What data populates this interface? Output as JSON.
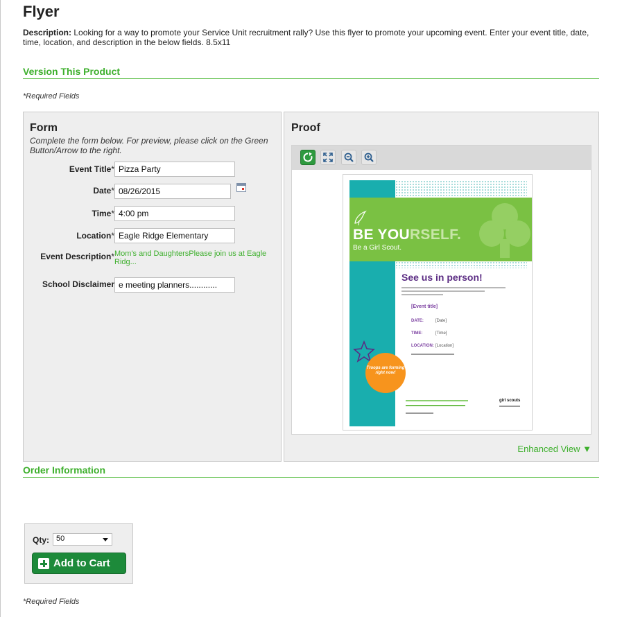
{
  "page": {
    "title": "Flyer",
    "description_label": "Description:",
    "description": "Looking for a way to promote your Service Unit recruitment rally? Use this flyer to promote your upcoming event. Enter your event title, date, time, location, and description in the below fields. 8.5x11"
  },
  "sections": {
    "version": "Version This Product",
    "order": "Order Information",
    "required_top": "*Required Fields",
    "required_bottom": "*Required Fields"
  },
  "form": {
    "title": "Form",
    "help": "Complete the form below. For preview, please click on the Green Button/Arrow to the right.",
    "fields": {
      "event_title": {
        "label": "Event Title",
        "value": "Pizza Party"
      },
      "date": {
        "label": "Date",
        "value": "08/26/2015"
      },
      "time": {
        "label": "Time",
        "value": "4:00 pm"
      },
      "location": {
        "label": "Location",
        "value": "Eagle Ridge Elementary"
      },
      "event_description": {
        "label": "Event Description",
        "value": "Mom's and DaughtersPlease join us at Eagle Ridg..."
      },
      "school_disclaimer": {
        "label": "School Disclaimer",
        "value": "e meeting planners............"
      }
    },
    "required_marker": "*"
  },
  "proof": {
    "title": "Proof",
    "toolbar": [
      "refresh-icon",
      "fit-screen-icon",
      "zoom-out-icon",
      "zoom-in-icon"
    ],
    "enhanced_view": "Enhanced View ▼",
    "flyer": {
      "headline_a": "BE YOU",
      "headline_b": "RSELF.",
      "subhead": "Be a Girl Scout.",
      "see_us": "See us in person!",
      "event_title": "[Event title]",
      "date_label": "DATE:",
      "date_value": "[Date]",
      "time_label": "TIME:",
      "time_value": "[Time]",
      "location_label": "LOCATION:",
      "location_value": "[Location]",
      "badge": "Troops are forming right now!",
      "brand": "girl scouts"
    },
    "colors": {
      "teal": "#19aeae",
      "green": "#7ac143",
      "purple": "#5b2c83",
      "orange": "#f7941d"
    }
  },
  "order": {
    "qty_label": "Qty:",
    "qty_value": "50",
    "add_to_cart": "Add to Cart"
  },
  "theme": {
    "accent": "#3daf2c",
    "button": "#1d8a3a"
  }
}
